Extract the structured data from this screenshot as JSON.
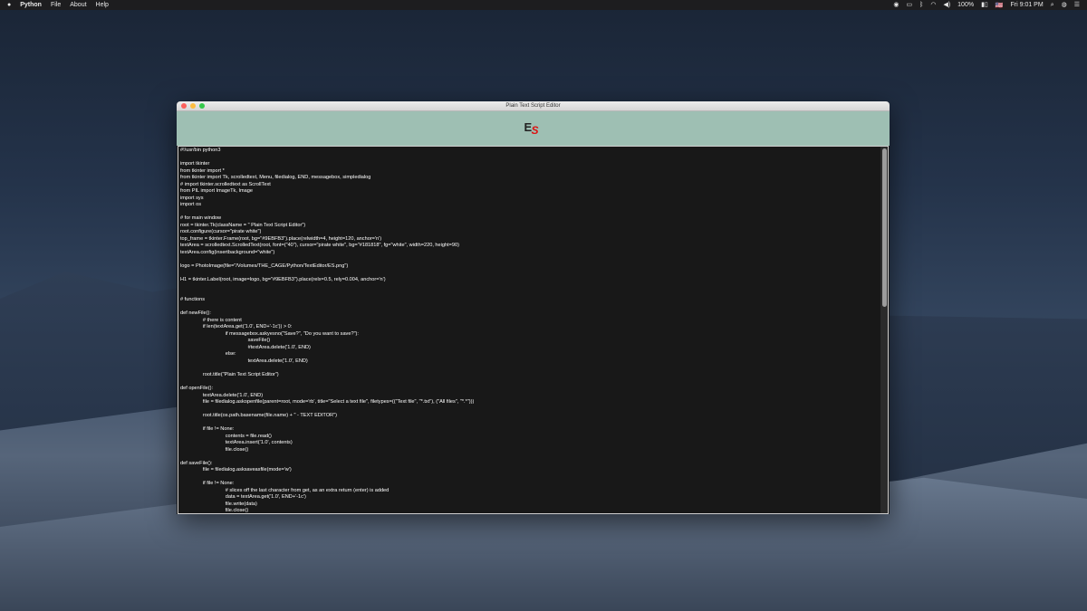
{
  "menubar": {
    "apple": "",
    "app": "Python",
    "items": [
      "File",
      "About",
      "Help"
    ],
    "battery": "100%",
    "flag": "🇺🇸",
    "clock": "Fri 9:01 PM"
  },
  "window": {
    "title": "Plain Text Script Editor",
    "logo": {
      "e": "E",
      "s": "S"
    }
  },
  "editor": {
    "lines": [
      "#!/usr/bin python3",
      "",
      "import tkinter",
      "from tkinter import *",
      "from tkinter import Tk, scrolledtext, Menu, filedialog, END, messagebox, simpledialog",
      "# import tkinter.scrolledtext as ScrollText",
      "from PIL import ImageTk, Image",
      "import sys",
      "import os",
      "",
      "# for main window",
      "root = tkinter.Tk(className = \" Plain Text Script Editor\")",
      "root.configure(cursor=\"pirate white\")",
      "top_frame = tkinter.Frame(root, bg=\"#9EBFB3\").place(relwidth=4, height=120, anchor='n')",
      "textArea = scrolledtext.ScrolledText(root, font=(\"40\"), cursor=\"pirate white\", bg=\"#181818\", fg=\"white\", width=220, height=90)",
      "textArea.config(insertbackground=\"white\")",
      "",
      "logo = PhotoImage(file=\"/Volumes/THE_CAGE/Python/TextEditor/ES.png\")",
      "",
      "H1 = tkinter.Label(root, image=logo, bg=\"#9EBFB3\").place(relx=0.5, rely=0.004, anchor='n')",
      "",
      "",
      "# functions",
      "",
      "def newFile():",
      "\t\t# there is content",
      "\t\tif len(textArea.get('1.0', END+'-1c')) > 0:",
      "\t\t\t\tif messagebox.askyesno(\"Save?\", \"Do you want to save?\"):",
      "\t\t\t\t\t\tsaveFile()",
      "\t\t\t\t\t\t#textArea.delete('1.0', END)",
      "\t\t\t\telse:",
      "\t\t\t\t\t\ttextArea.delete('1.0', END)",
      "",
      "\t\troot.title(\"Plain Text Script Editor\")",
      "",
      "def openFile():",
      "\t\ttextArea.delete('1.0', END)",
      "\t\tfile = filedialog.askopenfile(parent=root, mode='rb', title=\"Select a text file\", filetypes=((\"Text file\", \"*.txt\"), (\"All files\", \"*.*\")))",
      "",
      "\t\troot.title(os.path.basename(file.name) + \" - TEXT EDITOR\")",
      "",
      "\t\tif file != None:",
      "\t\t\t\tcontents = file.read()",
      "\t\t\t\ttextArea.insert('1.0', contents)",
      "\t\t\t\tfile.close()",
      "",
      "def saveFile():",
      "\t\tfile = filedialog.asksaveasfile(mode='w')",
      "",
      "\t\tif file != None:",
      "\t\t\t\t# slices off the last character from get, as an extra return (enter) is added",
      "\t\t\t\tdata = textArea.get('1.0', END+'-1c')",
      "\t\t\t\tfile.write(data)",
      "\t\t\t\tfile.close()"
    ]
  }
}
